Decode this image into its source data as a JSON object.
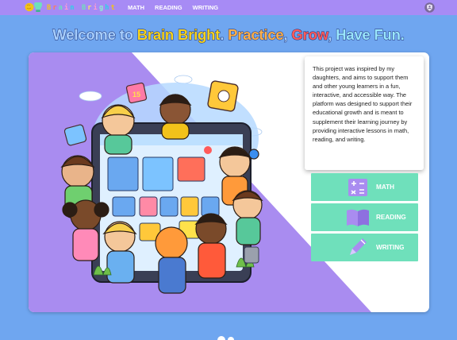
{
  "app": {
    "name_parts": [
      {
        "t": "B",
        "c": "#f2c21a"
      },
      {
        "t": "r",
        "c": "#ff7a59"
      },
      {
        "t": "a",
        "c": "#6fe0bb"
      },
      {
        "t": "i",
        "c": "#ff9ad2"
      },
      {
        "t": "n",
        "c": "#2bd3e6"
      },
      {
        "t": " ",
        "c": "#ffffff"
      },
      {
        "t": "B",
        "c": "#6fe0bb"
      },
      {
        "t": "r",
        "c": "#f7e36a"
      },
      {
        "t": "i",
        "c": "#ff9ad2"
      },
      {
        "t": "g",
        "c": "#8ff0d0"
      },
      {
        "t": "h",
        "c": "#2bd3e6"
      },
      {
        "t": "t",
        "c": "#f2c21a"
      }
    ]
  },
  "nav": {
    "math": "MATH",
    "reading": "READING",
    "writing": "WRITING"
  },
  "headline": [
    {
      "text": "Welcome to ",
      "color": "#a8d0ff"
    },
    {
      "text": "Brain Bright",
      "color": "#f7d31e"
    },
    {
      "text": ". ",
      "color": "#a8d0ff"
    },
    {
      "text": "Practice",
      "color": "#ffb14a"
    },
    {
      "text": ", ",
      "color": "#a8d0ff"
    },
    {
      "text": "Grow",
      "color": "#ff5a5a"
    },
    {
      "text": ", ",
      "color": "#a8d0ff"
    },
    {
      "text": "Have Fun.",
      "color": "#9ae7ff"
    }
  ],
  "info": "This project was inspired by my daughters, and aims to support them and other young learners in a fun, interactive, and accessible way. The platform was designed to support their educational growth and is meant to supplement their learning journey by providing interactive lessons in math, reading, and writing.",
  "subjects": {
    "math": "MATH",
    "reading": "READING",
    "writing": "WRITING"
  },
  "colors": {
    "navbar": "#a78bf5",
    "page_bg": "#6fa6f0",
    "card_purple": "#a98cf0",
    "subject_button": "#6fe0bb"
  },
  "icons": {
    "logo": "brain-lightbulb-icon",
    "user": "user-shield-icon",
    "math": "calculator-icon",
    "reading": "open-book-icon",
    "writing": "pencil-icon"
  }
}
